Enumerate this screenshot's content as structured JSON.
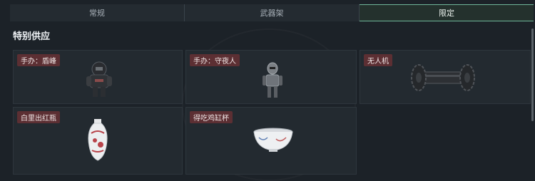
{
  "tabs": [
    {
      "label": "常规",
      "active": false
    },
    {
      "label": "武器架",
      "active": false
    },
    {
      "label": "限定",
      "active": true
    }
  ],
  "section": {
    "title": "特别供应"
  },
  "items": [
    {
      "label": "手办：盾峰",
      "icon": "armored-figure-icon"
    },
    {
      "label": "手办：守夜人",
      "icon": "robot-figure-icon"
    },
    {
      "label": "无人机",
      "icon": "drone-roller-icon"
    },
    {
      "label": "白里出红瓶",
      "icon": "porcelain-vase-icon"
    },
    {
      "label": "得吃鸡缸杯",
      "icon": "porcelain-cup-icon"
    }
  ],
  "colors": {
    "accent": "#6fb69a",
    "label_bg": "#5c2f33",
    "background": "#1c2228"
  }
}
